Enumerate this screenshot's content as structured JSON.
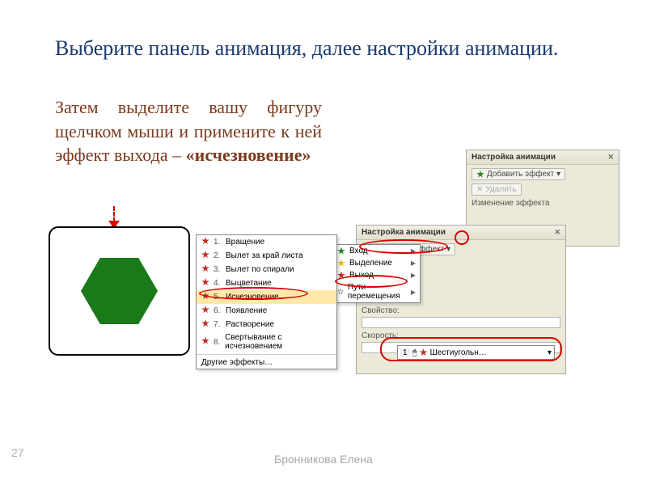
{
  "title": "Выберите панель анимация, далее настройки анимации.",
  "instruction_prefix": "Затем выделите вашу фигуру щелчком мыши и примените к ней эффект выхода – ",
  "instruction_bold": "«исчезновение»",
  "page_number": "27",
  "author": "Бронникова Елена",
  "panel": {
    "title": "Настройка анимации",
    "add_effect": "Добавить эффект",
    "remove": "Удалить",
    "property_label": "Свойство:",
    "speed_label": "Скорость:",
    "effect_label_trunc": "Изменение эффекта"
  },
  "add_menu": {
    "items": [
      {
        "icon": "green",
        "label": "Вход"
      },
      {
        "icon": "yellow",
        "label": "Выделение"
      },
      {
        "icon": "red",
        "label": "Выход"
      },
      {
        "icon": "path",
        "label": "Пути перемещения"
      }
    ]
  },
  "exit_effects": {
    "items": [
      "Вращение",
      "Вылет за край листа",
      "Вылет по спирали",
      "Выцветание",
      "Исчезновение",
      "Появление",
      "Растворение",
      "Свертывание с исчезновением"
    ],
    "more": "Другие эффекты…",
    "highlight_index": 4
  },
  "effect_list_item": {
    "index": "1",
    "name": "Шестиугольн…"
  }
}
